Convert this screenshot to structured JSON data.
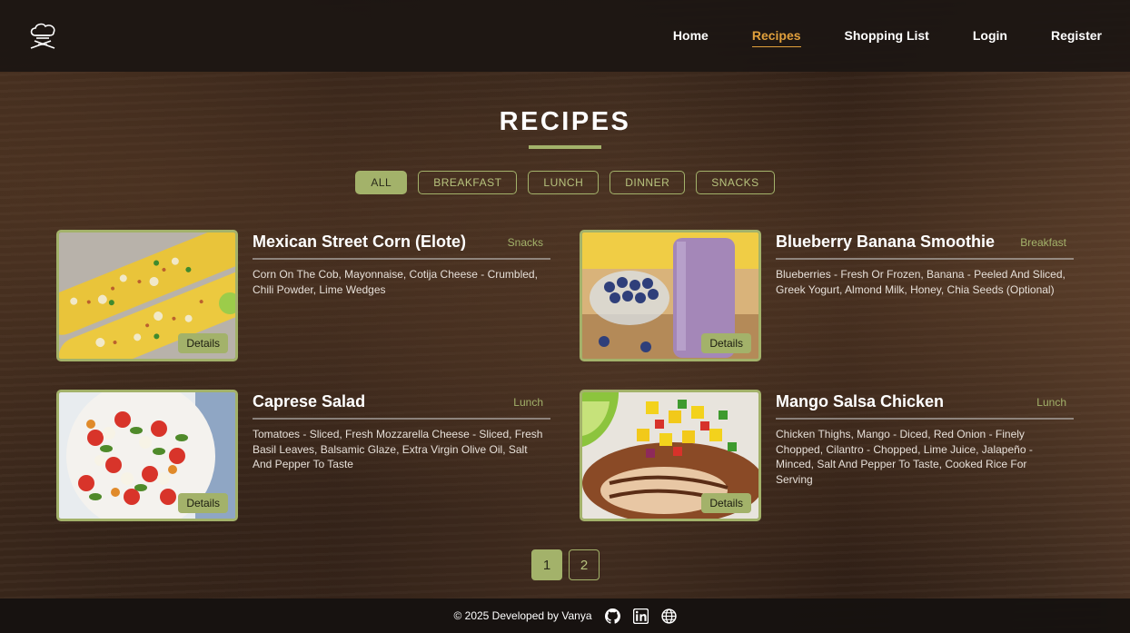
{
  "nav": {
    "items": [
      {
        "label": "Home",
        "active": false
      },
      {
        "label": "Recipes",
        "active": true
      },
      {
        "label": "Shopping List",
        "active": false
      },
      {
        "label": "Login",
        "active": false
      },
      {
        "label": "Register",
        "active": false
      }
    ]
  },
  "page": {
    "title": "RECIPES"
  },
  "filters": [
    "ALL",
    "BREAKFAST",
    "LUNCH",
    "DINNER",
    "SNACKS"
  ],
  "active_filter": "ALL",
  "recipes": [
    {
      "title": "Mexican Street Corn (Elote)",
      "category": "Snacks",
      "ingredients": "Corn On The Cob, Mayonnaise, Cotija Cheese - Crumbled, Chili Powder, Lime Wedges",
      "details_label": "Details",
      "image": "elote-photo"
    },
    {
      "title": "Blueberry Banana Smoothie",
      "category": "Breakfast",
      "ingredients": "Blueberries - Fresh Or Frozen, Banana - Peeled And Sliced, Greek Yogurt, Almond Milk, Honey, Chia Seeds (Optional)",
      "details_label": "Details",
      "image": "smoothie-photo"
    },
    {
      "title": "Caprese Salad",
      "category": "Lunch",
      "ingredients": "Tomatoes - Sliced, Fresh Mozzarella Cheese - Sliced, Fresh Basil Leaves, Balsamic Glaze, Extra Virgin Olive Oil, Salt And Pepper To Taste",
      "details_label": "Details",
      "image": "caprese-photo"
    },
    {
      "title": "Mango Salsa Chicken",
      "category": "Lunch",
      "ingredients": "Chicken Thighs, Mango - Diced, Red Onion - Finely Chopped, Cilantro - Chopped, Lime Juice, Jalapeño - Minced, Salt And Pepper To Taste, Cooked Rice For Serving",
      "details_label": "Details",
      "image": "mango-chicken-photo"
    }
  ],
  "pagination": {
    "pages": [
      "1",
      "2"
    ],
    "current": "1"
  },
  "footer": {
    "text": "© 2025 Developed by Vanya",
    "icons": [
      "github-icon",
      "linkedin-icon",
      "globe-icon"
    ]
  },
  "colors": {
    "accent": "#a3b26a",
    "nav_active": "#e0a03c",
    "header_bg": "#1c1613"
  }
}
